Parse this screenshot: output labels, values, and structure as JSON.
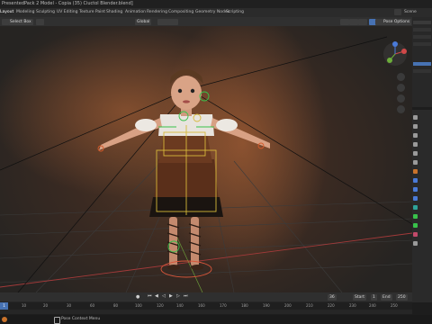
{
  "window": {
    "title": "PresentedPack 2 Model - Copia (35) Ciuctol Blender.blend]"
  },
  "workspace_tabs": [
    {
      "label": "Layout",
      "active": true
    },
    {
      "label": "Modeling"
    },
    {
      "label": "Sculpting"
    },
    {
      "label": "UV Editing"
    },
    {
      "label": "Texture Paint"
    },
    {
      "label": "Shading"
    },
    {
      "label": "Animation"
    },
    {
      "label": "Rendering"
    },
    {
      "label": "Compositing"
    },
    {
      "label": "Geometry Nodes"
    },
    {
      "label": "Scripting"
    }
  ],
  "topbar_right": {
    "scene_label": "Scene"
  },
  "viewport_header": {
    "select_box": "Select Box",
    "orientation": "Global",
    "pose_options": "Pose Options"
  },
  "timeline": {
    "current_frame": "1",
    "start_label": "Start",
    "start_value": "1",
    "end_label": "End",
    "end_value": "250",
    "frame_field": "36",
    "ruler_ticks": [
      "10",
      "20",
      "30",
      "60",
      "80",
      "100",
      "120",
      "140",
      "160",
      "170",
      "180",
      "190",
      "200",
      "210",
      "220",
      "230",
      "240",
      "250"
    ]
  },
  "statusbar": {
    "hint": "Pose Context Menu"
  },
  "colors": {
    "accent_blue": "#4772b3",
    "bone_green": "#38c24a",
    "bone_yellow": "#d6b83a",
    "grid_line": "#3b3b3b"
  },
  "icons": [
    "blender-logo-icon",
    "play-icon",
    "jump-start-icon",
    "jump-end-icon",
    "step-back-icon",
    "step-forward-icon",
    "keyframe-icon",
    "hand-icon",
    "zoom-icon",
    "camera-icon",
    "grid-icon",
    "eye-icon"
  ]
}
